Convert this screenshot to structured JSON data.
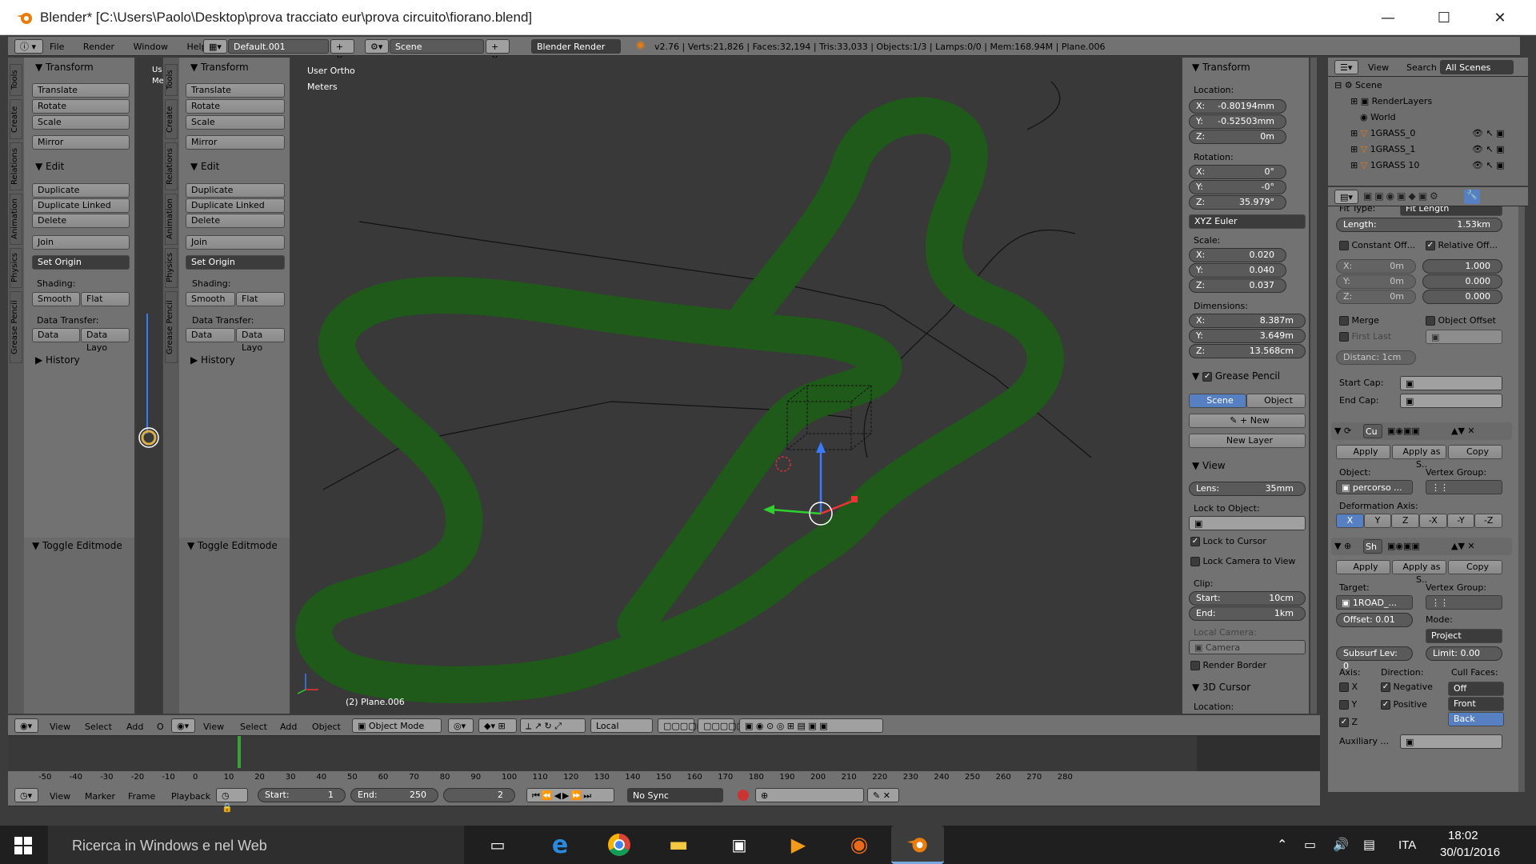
{
  "window": {
    "title": "Blender* [C:\\Users\\Paolo\\Desktop\\prova tracciato eur\\prova circuito\\fiorano.blend]",
    "minimize": "—",
    "maximize": "☐",
    "close": "✕"
  },
  "topbar": {
    "menus": [
      "File",
      "Render",
      "Window",
      "Help"
    ],
    "screen_layout": "Default.001",
    "scene": "Scene",
    "engine": "Blender Render",
    "stats": "v2.76 | Verts:21,826 | Faces:32,194 | Tris:33,033 | Objects:1/3 | Lamps:0/0 | Mem:168.94M | Plane.006"
  },
  "toolshelf": {
    "tabs": [
      "Tools",
      "Create",
      "Relations",
      "Animation",
      "Physics",
      "Grease Pencil"
    ],
    "transform_header": "Transform",
    "transform_buttons": [
      "Translate",
      "Rotate",
      "Scale",
      "Mirror"
    ],
    "edit_header": "Edit",
    "edit_buttons": [
      "Duplicate",
      "Duplicate Linked",
      "Delete",
      "Join"
    ],
    "set_origin": "Set Origin",
    "shading_label": "Shading:",
    "smooth": "Smooth",
    "flat": "Flat",
    "data_transfer_label": "Data Transfer:",
    "data": "Data",
    "data_layo": "Data Layo",
    "history": "History",
    "toggle_editmode": "Toggle Editmode"
  },
  "leftview": {
    "label_us": "Us",
    "label_me": "Me",
    "menus": [
      "View",
      "Select",
      "Add",
      "O"
    ]
  },
  "viewport": {
    "view_name": "User Ortho",
    "units": "Meters",
    "object_name": "(2) Plane.006",
    "menus": [
      "View",
      "Select",
      "Add",
      "Object"
    ],
    "mode": "Object Mode",
    "orientation": "Local"
  },
  "npanel": {
    "transform_header": "Transform",
    "location_label": "Location:",
    "loc": [
      {
        "k": "X:",
        "v": "-0.80194mm"
      },
      {
        "k": "Y:",
        "v": "-0.52503mm"
      },
      {
        "k": "Z:",
        "v": "0m"
      }
    ],
    "rotation_label": "Rotation:",
    "rot": [
      {
        "k": "X:",
        "v": "0°"
      },
      {
        "k": "Y:",
        "v": "-0°"
      },
      {
        "k": "Z:",
        "v": "35.979°"
      }
    ],
    "rot_mode": "XYZ Euler",
    "scale_label": "Scale:",
    "scale": [
      {
        "k": "X:",
        "v": "0.020"
      },
      {
        "k": "Y:",
        "v": "0.040"
      },
      {
        "k": "Z:",
        "v": "0.037"
      }
    ],
    "dim_label": "Dimensions:",
    "dim": [
      {
        "k": "X:",
        "v": "8.387m"
      },
      {
        "k": "Y:",
        "v": "3.649m"
      },
      {
        "k": "Z:",
        "v": "13.568cm"
      }
    ],
    "gp_header": "Grease Pencil",
    "gp_scene": "Scene",
    "gp_object": "Object",
    "gp_new": "New",
    "gp_new_layer": "New Layer",
    "view_header": "View",
    "lens_k": "Lens:",
    "lens_v": "35mm",
    "lock_obj": "Lock to Object:",
    "lock_cursor": "Lock to Cursor",
    "lock_camera": "Lock Camera to View",
    "clip_label": "Clip:",
    "clip_start_k": "Start:",
    "clip_start_v": "10cm",
    "clip_end_k": "End:",
    "clip_end_v": "1km",
    "local_camera": "Local Camera:",
    "camera": "Camera",
    "render_border": "Render Border",
    "cursor_header": "3D Cursor",
    "cursor_location": "Location:"
  },
  "outliner": {
    "menus": [
      "View",
      "Search"
    ],
    "filter": "All Scenes",
    "items": [
      "Scene",
      "RenderLayers",
      "World",
      "1GRASS_0",
      "1GRASS_1",
      "1GRASS 10"
    ]
  },
  "properties": {
    "fit_type_label": "Fit Type:",
    "fit_type": "Fit Length",
    "length_k": "Length:",
    "length_v": "1.53km",
    "constant_off": "Constant Off...",
    "relative_off": "Relative Off...",
    "const": [
      {
        "k": "X:",
        "v": "0m"
      },
      {
        "k": "Y:",
        "v": "0m"
      },
      {
        "k": "Z:",
        "v": "0m"
      }
    ],
    "rel": [
      "1.000",
      "0.000",
      "0.000"
    ],
    "merge": "Merge",
    "object_offset": "Object Offset",
    "first_last": "First Last",
    "distance": "Distanc: 1cm",
    "start_cap": "Start Cap:",
    "end_cap": "End Cap:",
    "mod1_name": "Cu",
    "apply": "Apply",
    "apply_as": "Apply as S..",
    "copy": "Copy",
    "object_label": "Object:",
    "vertex_group": "Vertex Group:",
    "object_value": "percorso ...",
    "deform_axis": "Deformation Axis:",
    "axes": [
      "X",
      "Y",
      "Z",
      "-X",
      "-Y",
      "-Z"
    ],
    "mod2_name": "Sh",
    "target_label": "Target:",
    "target_value": "1ROAD_...",
    "offset": "Offset: 0.01",
    "mode_label": "Mode:",
    "mode_value": "Project",
    "subsurf": "Subsurf Lev: 0",
    "limit": "Limit:  0.00",
    "axis_label": "Axis:",
    "direction_label": "Direction:",
    "cull_label": "Cull Faces:",
    "ax_x": "X",
    "ax_y": "Y",
    "ax_z": "Z",
    "negative": "Negative",
    "positive": "Positive",
    "cull_off": "Off",
    "cull_front": "Front",
    "cull_back": "Back",
    "auxiliary": "Auxiliary ..."
  },
  "timeline": {
    "ticks": [
      "-50",
      "-40",
      "-30",
      "-20",
      "-10",
      "0",
      "10",
      "20",
      "30",
      "40",
      "50",
      "60",
      "70",
      "80",
      "90",
      "100",
      "110",
      "120",
      "130",
      "140",
      "150",
      "160",
      "170",
      "180",
      "190",
      "200",
      "210",
      "220",
      "230",
      "240",
      "250",
      "260",
      "270",
      "280"
    ],
    "menus": [
      "View",
      "Marker",
      "Frame",
      "Playback"
    ],
    "start_k": "Start:",
    "start_v": "1",
    "end_k": "End:",
    "end_v": "250",
    "current": "2",
    "sync": "No Sync"
  },
  "taskbar": {
    "search": "Ricerca in Windows e nel Web",
    "lang": "ITA",
    "time": "18:02",
    "date": "30/01/2016"
  },
  "colors": {
    "track_outer": "#1f5a1a",
    "track_inner": "#d8b04a",
    "viewport_bg": "#393939",
    "selected": "#5680c2"
  }
}
